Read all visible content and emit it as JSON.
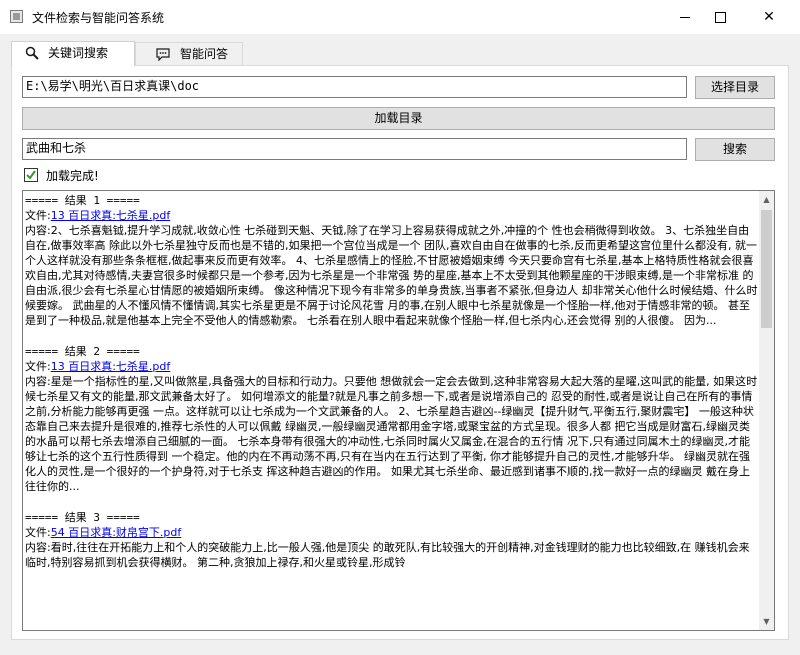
{
  "window": {
    "title": "文件检索与智能问答系统"
  },
  "tabs": [
    {
      "label": "关键词搜索",
      "icon": "search-icon",
      "active": true
    },
    {
      "label": "智能问答",
      "icon": "chat-icon",
      "active": false
    }
  ],
  "directory": {
    "path": "E:\\易学\\明光\\百日求真课\\doc",
    "choose_label": "选择目录",
    "load_label": "加载目录"
  },
  "search": {
    "query": "武曲和七杀",
    "button_label": "搜索"
  },
  "status": {
    "checked": true,
    "text": "加载完成!"
  },
  "results": [
    {
      "header": "===== 结果 1 =====",
      "file_prefix": "文件:",
      "file_name": "13 百日求真:七杀星.pdf",
      "content": "内容:2、七杀喜魁钺,提升学习成就,收敛心性 七杀碰到天魁、天钺,除了在学习上容易获得成就之外,冲撞的个 性也会稍微得到收敛。 3、七杀独坐自由自在,做事效率高 除此以外七杀星独守反而也是不错的,如果把一个宫位当成是一个 团队,喜欢自由自在做事的七杀,反而更希望这宫位里什么都没有, 就一个人这样就没有那些条条框框,做起事来反而更有效率。 4、七杀星感情上的怪脸,不甘愿被婚姻束缚 今天只要命宫有七杀星,基本上格特质性格就会很喜欢自由,尤其对待感情,夫妻宫很多时候都只是一个参考,因为七杀星是一个非常强 势的星座,基本上不太受到其他颗星座的干涉眼束缚,是一个非常标准 的自由派,很少会有七杀星心甘情愿的被婚姻所束缚。 像这种情况下现今有非常多的单身贵族,当事者不紧张,但身边人 却非常关心他什么时候结婚、什么时候要嫁。 武曲星的人不懂风情不懂情调,其实七杀星更是不屑于讨论风花雪 月的事,在别人眼中七杀星就像是一个怪胎一样,他对于情感非常的顿。 甚至是到了一种极品,就是他基本上完全不受他人的情感勒索。 七杀看在别人眼中看起来就像个怪胎一样,但七杀内心,还会觉得 别的人很傻。 因为..."
    },
    {
      "header": "===== 结果 2 =====",
      "file_prefix": "文件:",
      "file_name": "13 百日求真:七杀星.pdf",
      "content": "内容:星是一个指标性的星,又叫做煞星,具备强大的目标和行动力。只要他 想做就会一定会去做到,这种非常容易大起大落的星曜,这叫武的能量, 如果这时候七杀星又有文的能量,那文武兼备太好了。 如何增添文的能量?就是凡事之前多想一下,或者是说增添自己的 忍受的耐性,或者是说让自己在所有的事情之前,分析能力能够再更强 一点。这样就可以让七杀成为一个文武兼备的人。 2、七杀星趋吉避凶--绿幽灵【提升财气,平衡五行,聚财震宅】 一般这种状态靠自己来去提升是很难的,推荐七杀性的人可以佩戴 绿幽灵,一般绿幽灵通常都用金字塔,或聚宝盆的方式呈现。很多人都 把它当成是财富石,绿幽灵类的水晶可以帮七杀去增添自己细腻的一面。 七杀本身带有很强大的冲动性,七杀同时属火又属金,在混合的五行情 况下,只有通过同属木土的绿幽灵,才能够让七杀的这个五行性质得到 一个稳定。他的内在不再动荡不再,只有在当内在五行达到了平衡, 你才能够提升自己的灵性,才能够升华。 绿幽灵就在强化人的灵性,是一个很好的一个护身符,对于七杀支 挥这种趋吉避凶的作用。 如果尤其七杀坐命、最近感到诸事不顺的,找一款好一点的绿幽灵 戴在身上往往你的..."
    },
    {
      "header": "===== 结果 3 =====",
      "file_prefix": "文件:",
      "file_name": "54 百日求真:财帛宫下.pdf",
      "content": "内容:看时,往往在开拓能力上和个人的突破能力上,比一般人强,他是顶尖 的敢死队,有比较强大的开创精神,对金钱理财的能力也比较细致,在 赚钱机会来临时,特别容易抓到机会获得横财。 第二种,贪狼加上禄存,和火星或铃星,形成铃"
    }
  ]
}
